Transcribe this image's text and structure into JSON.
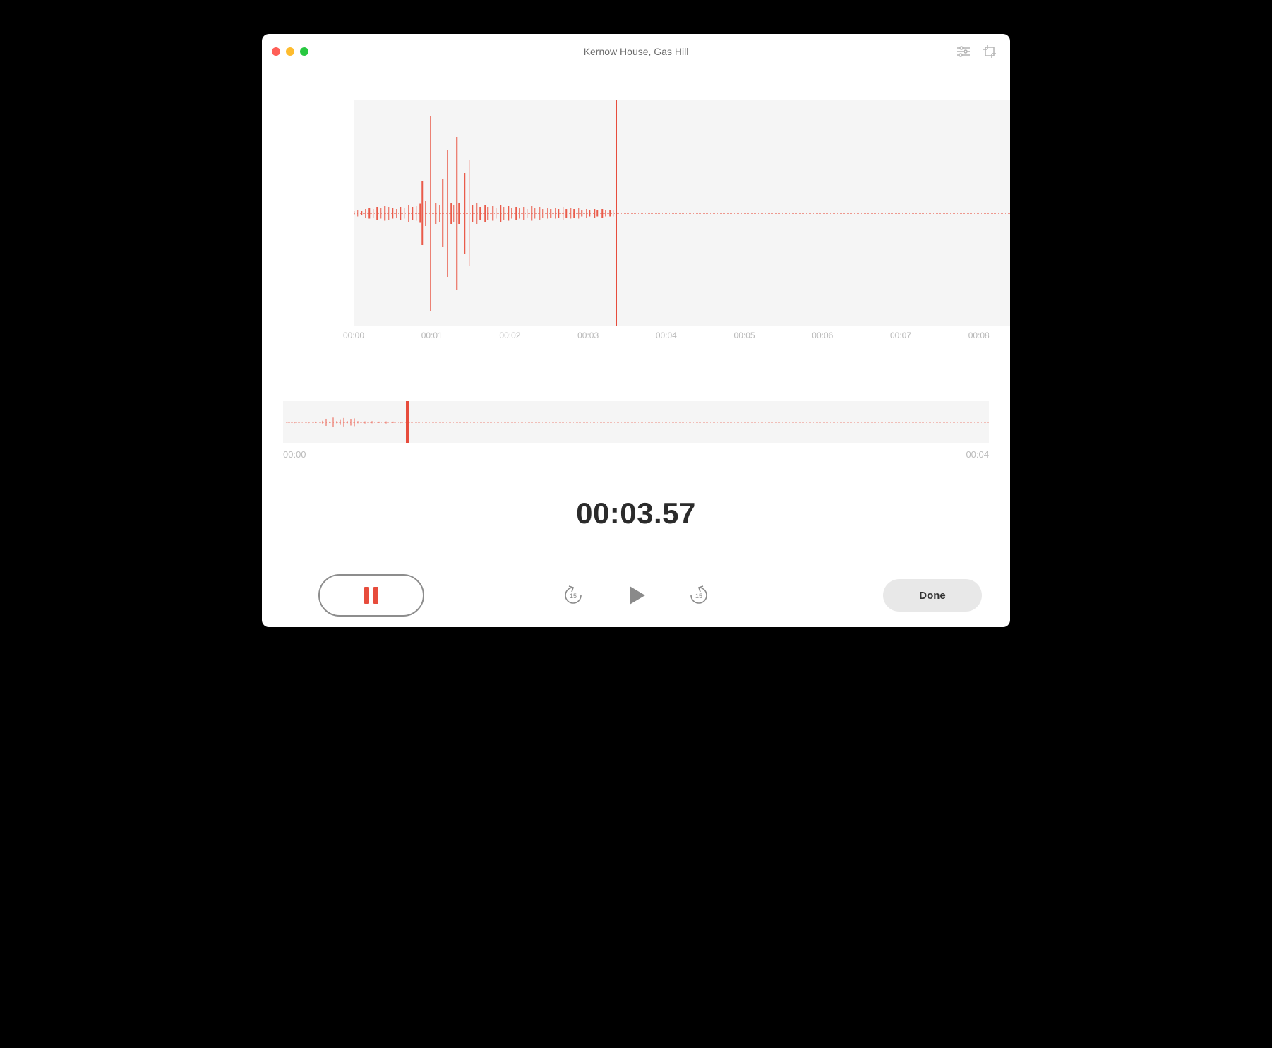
{
  "header": {
    "title": "Kernow House, Gas Hill"
  },
  "waveform": {
    "seconds_visible": 8.4,
    "playhead_seconds": 3.35,
    "ticks": [
      "00:00",
      "00:01",
      "00:02",
      "00:03",
      "00:04",
      "00:05",
      "00:06",
      "00:07",
      "00:08"
    ],
    "samples": [
      {
        "t": 0.0,
        "a": 2
      },
      {
        "t": 0.05,
        "a": 3
      },
      {
        "t": 0.1,
        "a": 2
      },
      {
        "t": 0.15,
        "a": 4
      },
      {
        "t": 0.2,
        "a": 5
      },
      {
        "t": 0.25,
        "a": 4
      },
      {
        "t": 0.3,
        "a": 6
      },
      {
        "t": 0.35,
        "a": 5
      },
      {
        "t": 0.4,
        "a": 7
      },
      {
        "t": 0.45,
        "a": 6
      },
      {
        "t": 0.5,
        "a": 5
      },
      {
        "t": 0.55,
        "a": 4
      },
      {
        "t": 0.6,
        "a": 6
      },
      {
        "t": 0.65,
        "a": 5
      },
      {
        "t": 0.7,
        "a": 8
      },
      {
        "t": 0.75,
        "a": 6
      },
      {
        "t": 0.8,
        "a": 7
      },
      {
        "t": 0.85,
        "a": 9
      },
      {
        "t": 0.88,
        "a": 30
      },
      {
        "t": 0.92,
        "a": 12
      },
      {
        "t": 0.98,
        "a": 92
      },
      {
        "t": 1.05,
        "a": 10
      },
      {
        "t": 1.1,
        "a": 8
      },
      {
        "t": 1.14,
        "a": 32
      },
      {
        "t": 1.2,
        "a": 60
      },
      {
        "t": 1.25,
        "a": 10
      },
      {
        "t": 1.28,
        "a": 8
      },
      {
        "t": 1.32,
        "a": 72
      },
      {
        "t": 1.35,
        "a": 10
      },
      {
        "t": 1.42,
        "a": 38
      },
      {
        "t": 1.48,
        "a": 50
      },
      {
        "t": 1.52,
        "a": 8
      },
      {
        "t": 1.58,
        "a": 10
      },
      {
        "t": 1.62,
        "a": 6
      },
      {
        "t": 1.68,
        "a": 8
      },
      {
        "t": 1.72,
        "a": 6
      },
      {
        "t": 1.78,
        "a": 7
      },
      {
        "t": 1.82,
        "a": 5
      },
      {
        "t": 1.88,
        "a": 8
      },
      {
        "t": 1.92,
        "a": 6
      },
      {
        "t": 1.98,
        "a": 7
      },
      {
        "t": 2.02,
        "a": 5
      },
      {
        "t": 2.08,
        "a": 6
      },
      {
        "t": 2.12,
        "a": 5
      },
      {
        "t": 2.18,
        "a": 6
      },
      {
        "t": 2.22,
        "a": 4
      },
      {
        "t": 2.28,
        "a": 7
      },
      {
        "t": 2.32,
        "a": 5
      },
      {
        "t": 2.38,
        "a": 6
      },
      {
        "t": 2.42,
        "a": 4
      },
      {
        "t": 2.48,
        "a": 5
      },
      {
        "t": 2.52,
        "a": 4
      },
      {
        "t": 2.58,
        "a": 5
      },
      {
        "t": 2.62,
        "a": 4
      },
      {
        "t": 2.68,
        "a": 6
      },
      {
        "t": 2.72,
        "a": 4
      },
      {
        "t": 2.78,
        "a": 5
      },
      {
        "t": 2.82,
        "a": 4
      },
      {
        "t": 2.88,
        "a": 5
      },
      {
        "t": 2.92,
        "a": 3
      },
      {
        "t": 2.98,
        "a": 4
      },
      {
        "t": 3.02,
        "a": 3
      },
      {
        "t": 3.08,
        "a": 4
      },
      {
        "t": 3.12,
        "a": 3
      },
      {
        "t": 3.18,
        "a": 4
      },
      {
        "t": 3.22,
        "a": 3
      },
      {
        "t": 3.28,
        "a": 3
      },
      {
        "t": 3.32,
        "a": 3
      }
    ]
  },
  "mini": {
    "start": "00:00",
    "end": "00:04",
    "duration_seconds": 4.0,
    "playhead_seconds": 0.68,
    "samples": [
      {
        "t": 0.0,
        "a": 2
      },
      {
        "t": 0.04,
        "a": 3
      },
      {
        "t": 0.08,
        "a": 2
      },
      {
        "t": 0.12,
        "a": 3
      },
      {
        "t": 0.16,
        "a": 4
      },
      {
        "t": 0.2,
        "a": 8
      },
      {
        "t": 0.22,
        "a": 18
      },
      {
        "t": 0.24,
        "a": 4
      },
      {
        "t": 0.26,
        "a": 24
      },
      {
        "t": 0.28,
        "a": 6
      },
      {
        "t": 0.3,
        "a": 12
      },
      {
        "t": 0.32,
        "a": 22
      },
      {
        "t": 0.34,
        "a": 6
      },
      {
        "t": 0.36,
        "a": 16
      },
      {
        "t": 0.38,
        "a": 20
      },
      {
        "t": 0.4,
        "a": 6
      },
      {
        "t": 0.44,
        "a": 5
      },
      {
        "t": 0.48,
        "a": 6
      },
      {
        "t": 0.52,
        "a": 4
      },
      {
        "t": 0.56,
        "a": 5
      },
      {
        "t": 0.6,
        "a": 4
      },
      {
        "t": 0.64,
        "a": 3
      },
      {
        "t": 0.68,
        "a": 3
      }
    ]
  },
  "time_display": "00:03.57",
  "controls": {
    "skip_seconds": "15",
    "done_label": "Done"
  },
  "colors": {
    "accent": "#e74c3c"
  }
}
